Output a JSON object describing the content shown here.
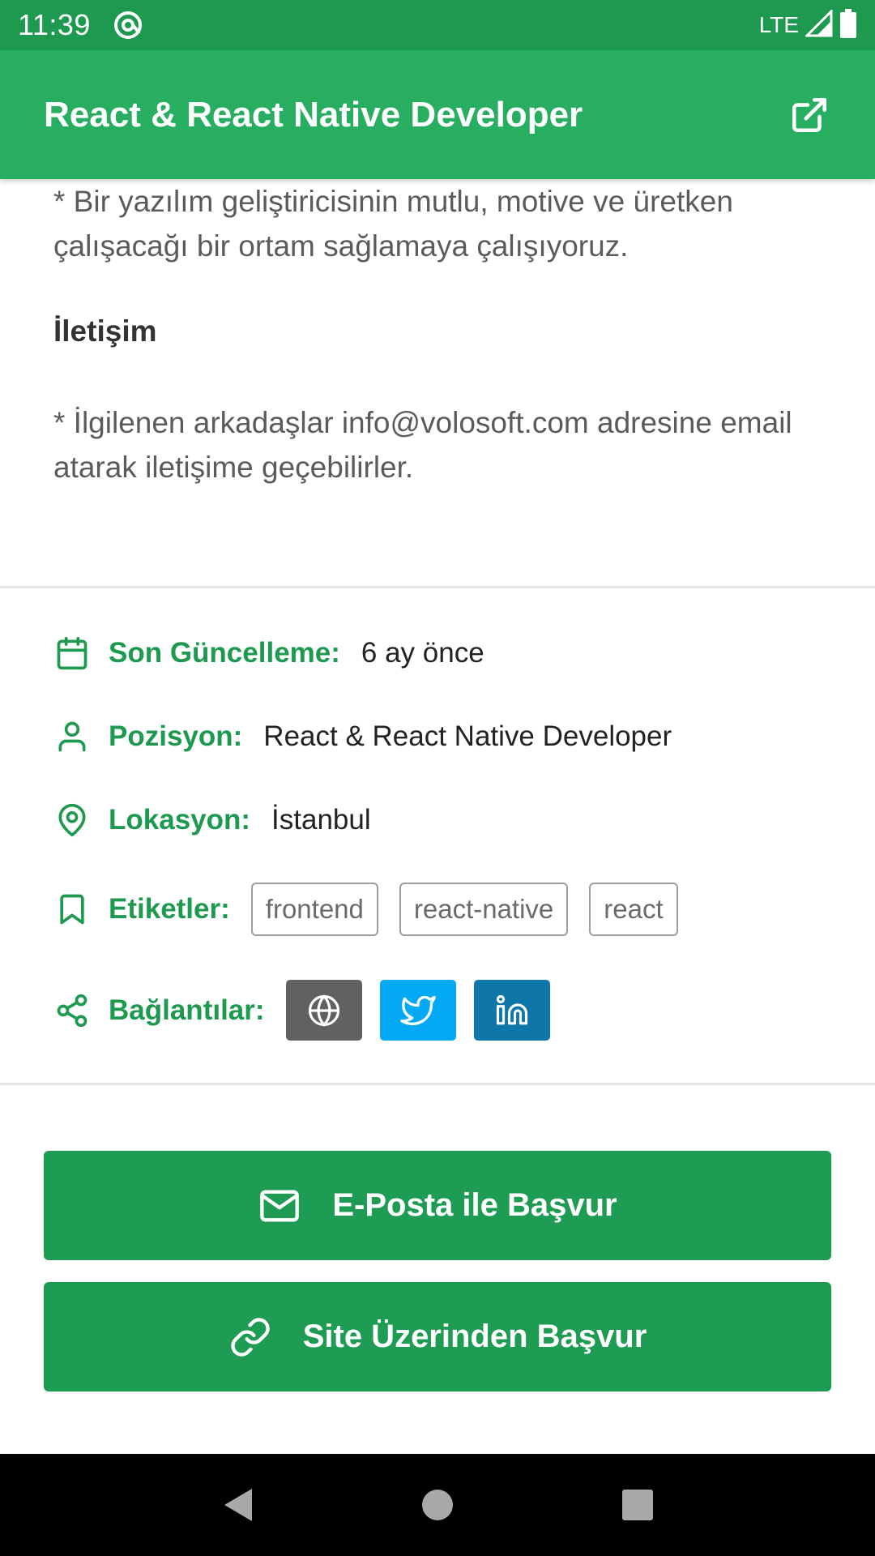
{
  "status_bar": {
    "time": "11:39",
    "network": "LTE"
  },
  "app_bar": {
    "title": "React & React Native Developer",
    "action_icon": "external-link-icon"
  },
  "description": {
    "paragraph_1": "* Bir yazılım geliştiricisinin mutlu, motive ve üretken çalışacağı bir ortam sağlamaya çalışıyoruz.",
    "heading": "İletişim",
    "paragraph_2": "* İlgilenen arkadaşlar info@volosoft.com adresine email atarak iletişime geçebilirler."
  },
  "info": {
    "updated": {
      "label": "Son Güncelleme:",
      "value": "6 ay önce",
      "icon": "calendar-icon"
    },
    "position": {
      "label": "Pozisyon:",
      "value": "React & React Native Developer",
      "icon": "user-icon"
    },
    "location": {
      "label": "Lokasyon:",
      "value": "İstanbul",
      "icon": "map-pin-icon"
    },
    "tags": {
      "label": "Etiketler:",
      "items": [
        "frontend",
        "react-native",
        "react"
      ],
      "icon": "bookmark-icon"
    },
    "links": {
      "label": "Bağlantılar:",
      "icon": "share-icon",
      "buttons": [
        {
          "name": "website",
          "icon": "globe-icon",
          "color": "#616161"
        },
        {
          "name": "twitter",
          "icon": "twitter-icon",
          "color": "#03a9f4"
        },
        {
          "name": "linkedin",
          "icon": "linkedin-icon",
          "color": "#0e76a8"
        }
      ]
    }
  },
  "actions": {
    "email_apply": "E-Posta ile Başvur",
    "site_apply": "Site Üzerinden Başvur"
  },
  "colors": {
    "status_bar": "#1e9a50",
    "app_bar": "#28ae60",
    "accent": "#1e9a50",
    "button": "#1f9c53"
  }
}
